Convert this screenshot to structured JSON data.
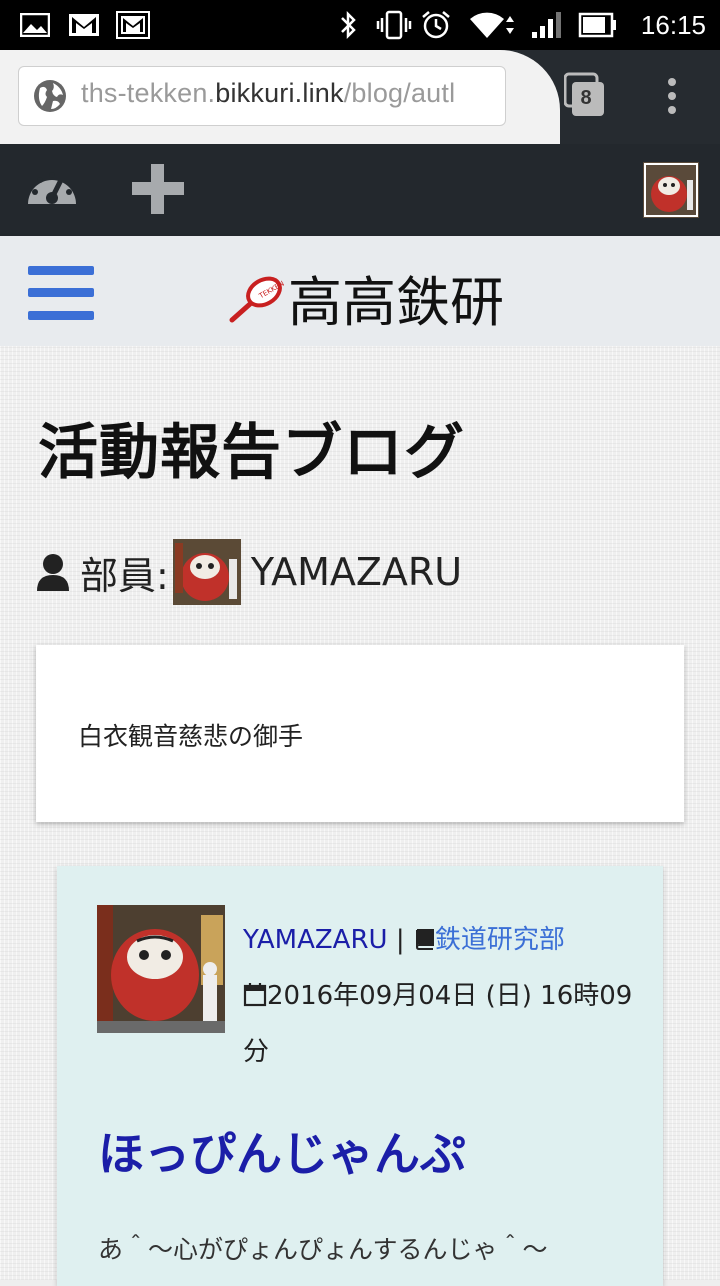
{
  "status_bar": {
    "time": "16:15",
    "left_icons": [
      "image-icon",
      "gmail-icon",
      "gmail-icon"
    ],
    "right_icons": [
      "bluetooth-icon",
      "vibrate-icon",
      "alarm-icon",
      "wifi-icon",
      "signal-icon",
      "battery-icon"
    ]
  },
  "browser": {
    "url_prefix": "ths-tekken.",
    "url_domain": "bikkuri.link",
    "url_suffix": "/blog/autl",
    "tab_count": "8"
  },
  "admin_bar": {
    "icons": [
      "dashboard-icon",
      "plus-icon",
      "avatar"
    ]
  },
  "header": {
    "site_title": "高高鉄研"
  },
  "page": {
    "heading": "活動報告ブログ",
    "author_label": "部員:",
    "author_name": "YAMAZARU",
    "bio": "白衣観音慈悲の御手"
  },
  "post": {
    "author": "YAMAZARU",
    "separator": " | ",
    "category": "鉄道研究部",
    "date": "2016年09月04日 (日) 16時09分",
    "title": "ほっぴんじゃんぷ",
    "excerpt": "あ＾～心がぴょんぴょんするんじゃ＾～"
  },
  "colors": {
    "accent_blue": "#3b6fd6",
    "link_navy": "#1b1ea8",
    "admin_bar": "#23282d",
    "post_card_bg": "#dff0f0"
  }
}
